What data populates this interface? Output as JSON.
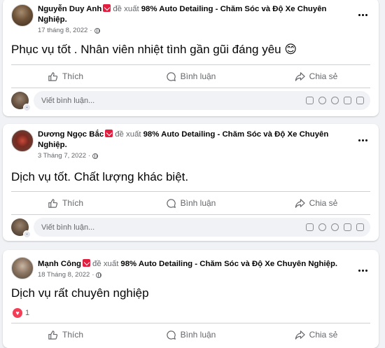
{
  "posts": [
    {
      "author": "Nguyễn Duy Anh",
      "recommends": "đề xuất",
      "page": "98% Auto Detailing - Chăm Sóc và Độ Xe Chuyên Nghiệp.",
      "date": "17 tháng 8, 2022",
      "separator": "·",
      "text": "Phục vụ tốt . Nhân viên nhiệt tình gần gũi đáng yêu 😊"
    },
    {
      "author": "Dương Ngọc Bắc",
      "recommends": "đề xuất",
      "page": "98% Auto Detailing - Chăm Sóc và Độ Xe Chuyên Nghiệp.",
      "date": "3 Tháng 7, 2022",
      "separator": "·",
      "text": "Dịch vụ tốt. Chất lượng khác biệt."
    },
    {
      "author": "Mạnh Công",
      "recommends": "đề xuất",
      "page": "98% Auto Detailing - Chăm Sóc và Độ Xe Chuyên Nghiệp.",
      "date": "18 Tháng 8, 2022",
      "separator": "·",
      "text": "Dịch vụ rất chuyên nghiệp",
      "reaction_count": "1"
    }
  ],
  "actions": {
    "like": "Thích",
    "comment": "Bình luận",
    "share": "Chia sẻ"
  },
  "comment_box": {
    "placeholder": "Viết bình luận..."
  },
  "icons": [
    "more-icon",
    "globe-icon",
    "recommend-icon",
    "like-icon",
    "comment-icon",
    "share-icon",
    "sticker-icon",
    "emoji-icon",
    "camera-icon",
    "gif-icon",
    "heart-icon"
  ],
  "colors": {
    "recommend": "#e41e3f",
    "heart": "#f33e58",
    "secondary_text": "#65676b"
  }
}
